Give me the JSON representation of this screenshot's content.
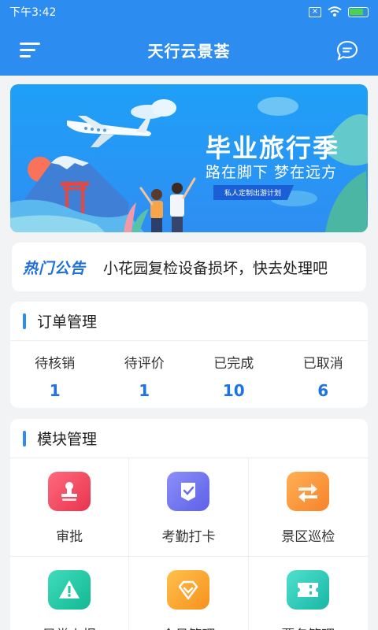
{
  "status_bar": {
    "time": "下午3:42",
    "sim_icon": "sim-off-icon",
    "wifi_icon": "wifi-icon",
    "battery_icon": "battery-charging-icon"
  },
  "header": {
    "title": "天行云景荟",
    "menu_icon": "menu-icon",
    "message_icon": "chat-icon"
  },
  "banner": {
    "title": "毕业旅行季",
    "subtitle": "路在脚下 梦在远方",
    "tag": "私人定制出游计划"
  },
  "notice": {
    "label": "热门公告",
    "text": "小花园复检设备损坏，快去处理吧"
  },
  "order_management": {
    "title": "订单管理",
    "items": [
      {
        "label": "待核销",
        "count": "1"
      },
      {
        "label": "待评价",
        "count": "1"
      },
      {
        "label": "已完成",
        "count": "10"
      },
      {
        "label": "已取消",
        "count": "6"
      }
    ]
  },
  "module_management": {
    "title": "模块管理",
    "items": [
      {
        "label": "审批",
        "icon": "stamp-icon",
        "color": "#f2475f"
      },
      {
        "label": "考勤打卡",
        "icon": "checkin-icon",
        "color": "#6b6ff0"
      },
      {
        "label": "景区巡检",
        "icon": "swap-arrows-icon",
        "color": "#fb9134"
      },
      {
        "label": "异常上报",
        "icon": "warning-icon",
        "color": "#1fc6a3"
      },
      {
        "label": "会员管理",
        "icon": "diamond-icon",
        "color": "#f9a530"
      },
      {
        "label": "票务管理",
        "icon": "ticket-icon",
        "color": "#27c8b5"
      }
    ]
  }
}
